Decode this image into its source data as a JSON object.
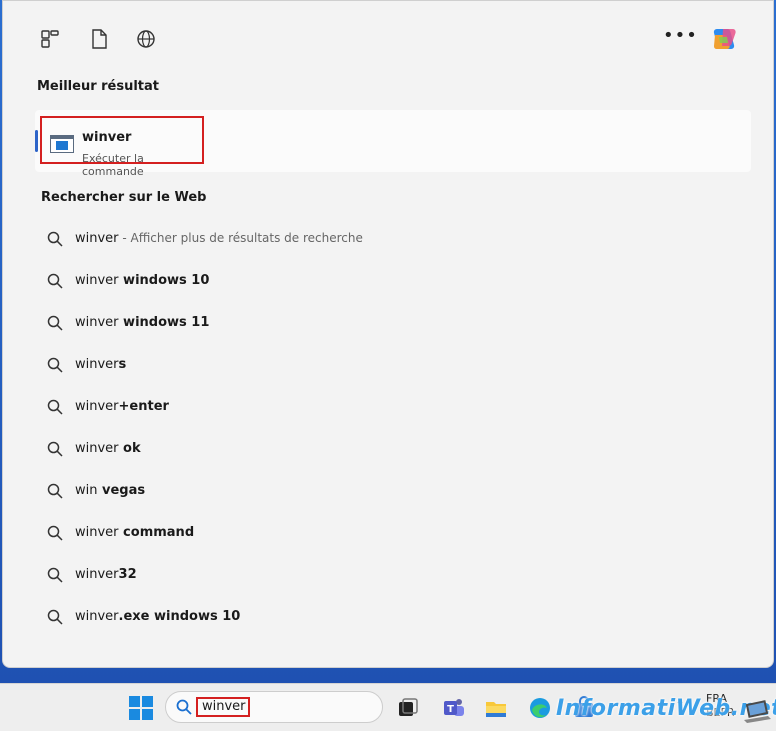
{
  "panel": {
    "top_icons": [
      "widgets-icon",
      "document-icon",
      "globe-icon"
    ],
    "more_label": "•••",
    "copilot_icon": "copilot-icon"
  },
  "best_result": {
    "title": "Meilleur résultat",
    "name": "winver",
    "subtitle": "Exécuter la commande"
  },
  "web_search": {
    "title": "Rechercher sur le Web",
    "items": [
      {
        "query": "winver",
        "bold": "",
        "extra": " - Afficher plus de résultats de recherche"
      },
      {
        "query": "winver",
        "bold": " windows 10",
        "extra": ""
      },
      {
        "query": "winver",
        "bold": " windows 11",
        "extra": ""
      },
      {
        "query": "winver",
        "bold": "s",
        "extra": ""
      },
      {
        "query": "winver",
        "bold": "+enter",
        "extra": ""
      },
      {
        "query": "winver",
        "bold": " ok",
        "extra": ""
      },
      {
        "query": "win",
        "bold": " vegas",
        "extra": ""
      },
      {
        "query": "winver",
        "bold": " command",
        "extra": ""
      },
      {
        "query": "winver",
        "bold": "32",
        "extra": ""
      },
      {
        "query": "winver",
        "bold": ".exe windows 10",
        "extra": ""
      }
    ]
  },
  "taskbar": {
    "search_value": "winver",
    "tray_lang": "FRA",
    "tray_region": "BEFR"
  },
  "watermark": "InformatiWeb.net",
  "colors": {
    "accent": "#2d64c8",
    "highlight_box": "#d42020",
    "panel_bg": "#f3f3f3"
  }
}
